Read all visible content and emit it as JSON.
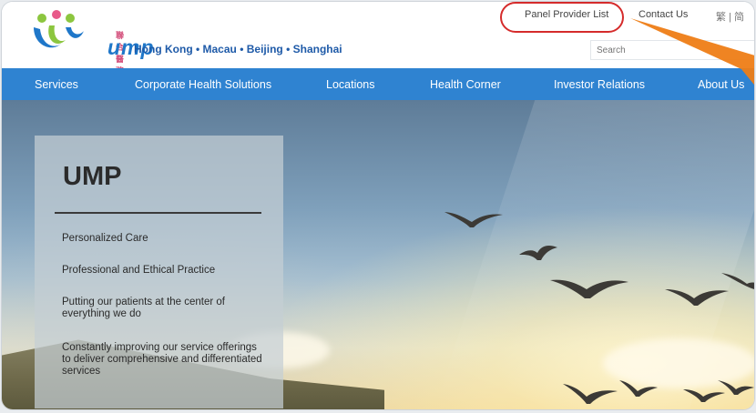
{
  "header": {
    "logo_chinese": "聯合醫務",
    "logo_text": "ump",
    "regions": "Hong Kong • Macau • Beijing • Shanghai",
    "links": {
      "panel_provider": "Panel Provider List",
      "contact": "Contact Us",
      "language": "繁 | 简"
    },
    "search_placeholder": "Search"
  },
  "nav": {
    "items": [
      "Services",
      "Corporate Health Solutions",
      "Locations",
      "Health Corner",
      "Investor Relations",
      "About Us"
    ]
  },
  "hero": {
    "title": "UMP",
    "bullets": [
      "Personalized Care",
      "Professional and Ethical Practice",
      "Putting our patients at the center of everything we do",
      "Constantly improving our service offerings to deliver comprehensive and differentiated services"
    ]
  },
  "colors": {
    "nav_blue": "#2f83d1",
    "brand_blue": "#1e5aa8",
    "highlight_red": "#d52b2b",
    "arrow_orange": "#ee7d16"
  }
}
